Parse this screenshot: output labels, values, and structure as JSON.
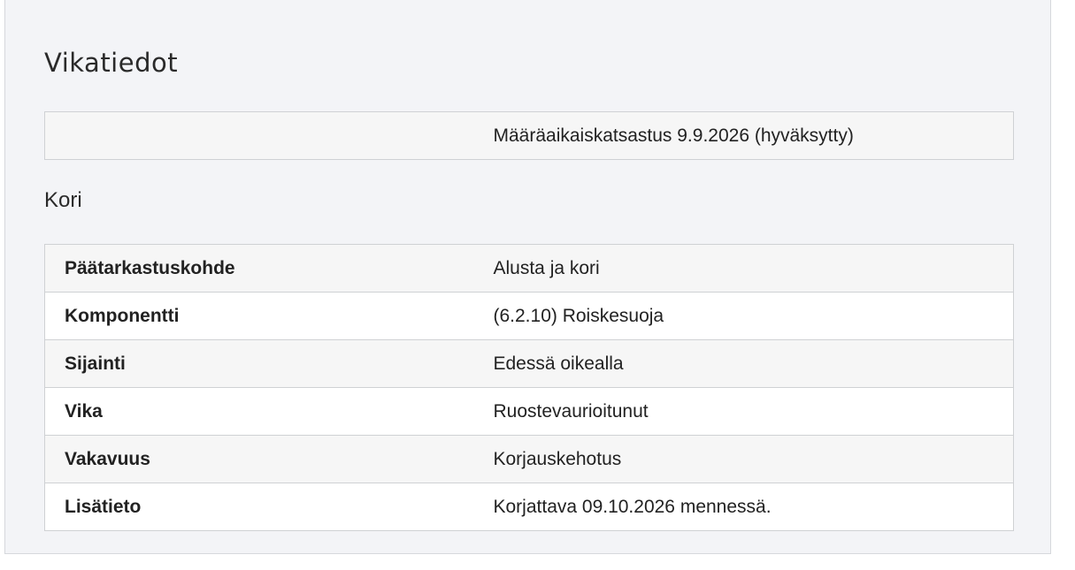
{
  "page_title": "Vikatiedot",
  "inspection": {
    "label": "",
    "value": "Määräaikaiskatsastus 9.9.2026 (hyväksytty)"
  },
  "section_title": "Kori",
  "details": [
    {
      "label": "Päätarkastuskohde",
      "value": "Alusta ja kori"
    },
    {
      "label": "Komponentti",
      "value": "(6.2.10) Roiskesuoja"
    },
    {
      "label": "Sijainti",
      "value": "Edessä oikealla"
    },
    {
      "label": "Vika",
      "value": "Ruostevaurioitunut"
    },
    {
      "label": "Vakavuus",
      "value": "Korjauskehotus"
    },
    {
      "label": "Lisätieto",
      "value": "Korjattava 09.10.2026 mennessä."
    }
  ]
}
